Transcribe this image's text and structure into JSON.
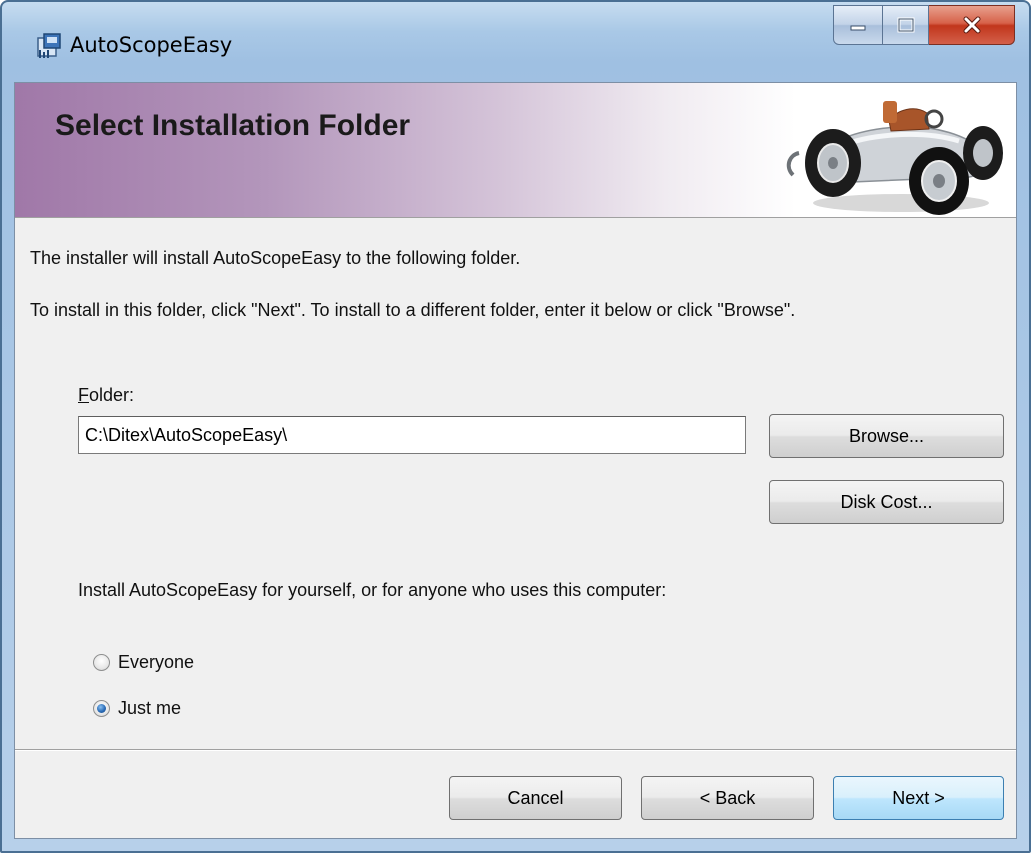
{
  "window": {
    "title": "AutoScopeEasy"
  },
  "banner": {
    "title": "Select Installation Folder",
    "logo_icon": "racing-car-icon"
  },
  "body": {
    "intro_text": "The installer will install AutoScopeEasy to the following folder.",
    "instructions_text": "To install in this folder, click \"Next\". To install to a different folder, enter it below or click \"Browse\".",
    "folder_label_access_key": "F",
    "folder_label_rest": "older:",
    "folder_value": "C:\\Ditex\\AutoScopeEasy\\",
    "browse_label": "Browse...",
    "disk_cost_label": "Disk Cost...",
    "install_for_text": "Install AutoScopeEasy for yourself, or for anyone who uses this computer:",
    "radio_options": [
      {
        "label": "Everyone",
        "checked": false
      },
      {
        "label": "Just me",
        "checked": true
      }
    ]
  },
  "footer": {
    "cancel_label": "Cancel",
    "back_label": "< Back",
    "next_label": "Next >"
  },
  "colors": {
    "banner_accent": "#a078a8",
    "dialog_background": "#f0f0f0",
    "default_button_border": "#3c7fb1",
    "close_button": "#c1361c"
  }
}
